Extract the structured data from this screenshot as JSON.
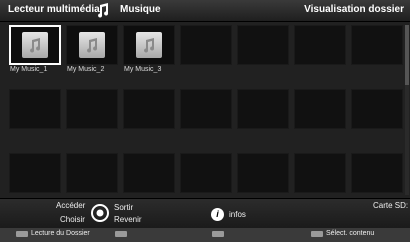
{
  "header": {
    "app_title": "Lecteur multimédia",
    "section_title": "Musique",
    "view_title": "Visualisation dossier"
  },
  "grid": {
    "folders": [
      {
        "label": "My Music_1",
        "selected": true
      },
      {
        "label": "My Music_2",
        "selected": false
      },
      {
        "label": "My Music_3",
        "selected": false
      }
    ]
  },
  "footer": {
    "acceder": "Accéder",
    "choisir": "Choisir",
    "sortir": "Sortir",
    "revenir": "Revenir",
    "infos": "infos",
    "info_glyph": "i",
    "source": "Carte SD:"
  },
  "bottombar": {
    "lecture": "Lecture du Dossier",
    "select": "Sélect. contenu"
  },
  "colors": {
    "background": "#1b1b1b",
    "tile": "#111111",
    "selection": "#ffffff"
  }
}
